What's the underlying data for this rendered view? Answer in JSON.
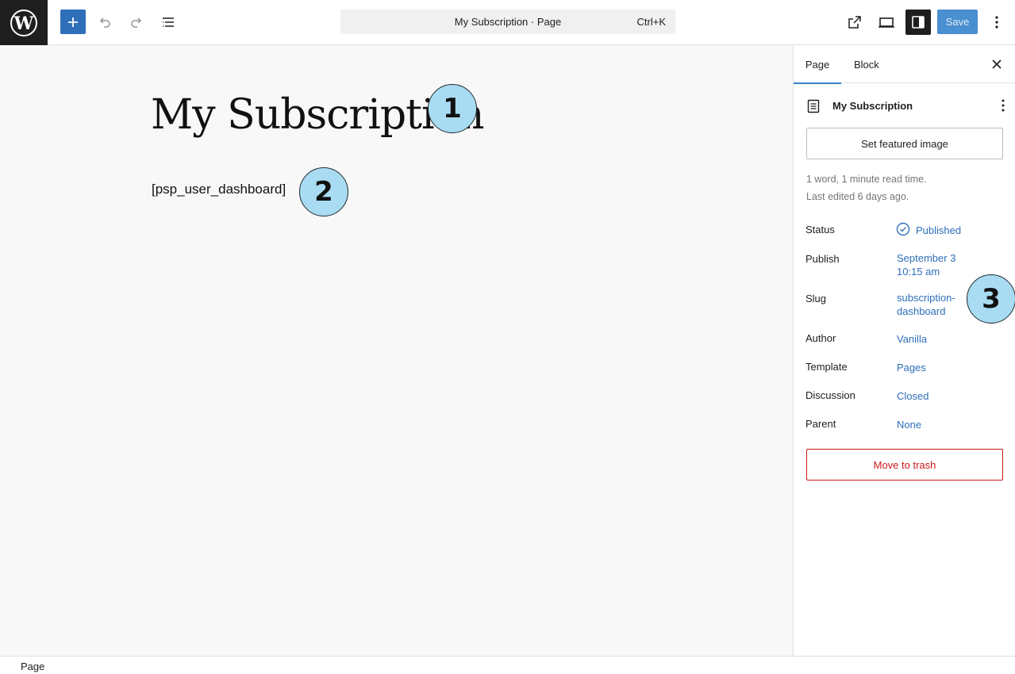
{
  "toolbar": {
    "command_title": "My Subscription · Page",
    "command_shortcut": "Ctrl+K",
    "save_label": "Save"
  },
  "editor": {
    "title": "My Subscription",
    "shortcode": "[psp_user_dashboard]"
  },
  "markers": [
    "1",
    "2",
    "3"
  ],
  "sidebar": {
    "tabs": [
      "Page",
      "Block"
    ],
    "document_title": "My Subscription",
    "featured_image_label": "Set featured image",
    "stats": "1 word, 1 minute read time.",
    "last_edited": "Last edited 6 days ago.",
    "properties": [
      {
        "label": "Status",
        "value": "Published"
      },
      {
        "label": "Publish",
        "value": "September 3",
        "value2": "10:15 am"
      },
      {
        "label": "Slug",
        "value": "subscription-",
        "value2": "dashboard"
      },
      {
        "label": "Author",
        "value": "Vanilla"
      },
      {
        "label": "Template",
        "value": "Pages"
      },
      {
        "label": "Discussion",
        "value": "Closed"
      },
      {
        "label": "Parent",
        "value": "None"
      }
    ],
    "trash_label": "Move to trash"
  },
  "footer": {
    "breadcrumb": "Page"
  },
  "colors": {
    "accent": "#2f6fba",
    "danger": "#cc1818",
    "marker": "#a9dcf2"
  }
}
